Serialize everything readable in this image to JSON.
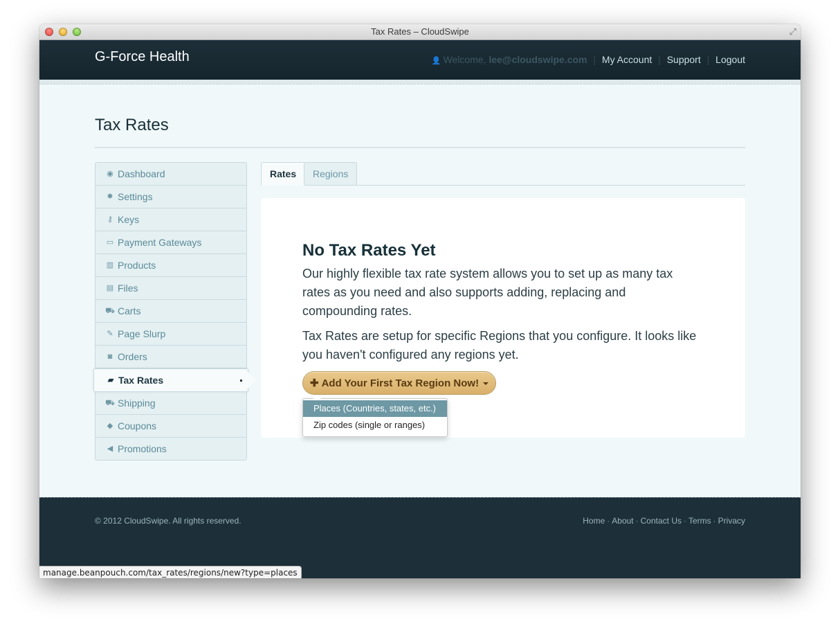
{
  "window": {
    "title": "Tax Rates – CloudSwipe"
  },
  "header": {
    "brand": "G-Force Health",
    "welcome_prefix": "Welcome,",
    "welcome_user": "lee@cloudswipe.com",
    "links": [
      "My Account",
      "Support",
      "Logout"
    ]
  },
  "page": {
    "title": "Tax Rates"
  },
  "sidebar": {
    "items": [
      {
        "label": "Dashboard",
        "icon": "dashboard-icon"
      },
      {
        "label": "Settings",
        "icon": "gear-icon"
      },
      {
        "label": "Keys",
        "icon": "key-icon"
      },
      {
        "label": "Payment Gateways",
        "icon": "credit-card-icon"
      },
      {
        "label": "Products",
        "icon": "barcode-icon"
      },
      {
        "label": "Files",
        "icon": "file-icon"
      },
      {
        "label": "Carts",
        "icon": "cart-icon"
      },
      {
        "label": "Page Slurp",
        "icon": "magic-wand-icon"
      },
      {
        "label": "Orders",
        "icon": "money-icon"
      },
      {
        "label": "Tax Rates",
        "icon": "book-icon",
        "active": true
      },
      {
        "label": "Shipping",
        "icon": "truck-icon"
      },
      {
        "label": "Coupons",
        "icon": "tags-icon"
      },
      {
        "label": "Promotions",
        "icon": "bullhorn-icon"
      }
    ]
  },
  "tabs": [
    "Rates",
    "Regions"
  ],
  "main": {
    "heading": "No Tax Rates Yet",
    "paragraph_1": "Our highly flexible tax rate system allows you to set up as many tax rates as you need and also supports adding, replacing and compounding rates.",
    "paragraph_2": "Tax Rates are setup for specific Regions that you configure. It looks like you haven't configured any regions yet.",
    "add_button": "Add Your First Tax Region Now!",
    "dropdown": [
      "Places (Countries, states, etc.)",
      "Zip codes (single or ranges)"
    ]
  },
  "footer": {
    "copyright": "© 2012 CloudSwipe. All rights reserved.",
    "links": [
      "Home",
      "About",
      "Contact Us",
      "Terms",
      "Privacy"
    ]
  },
  "status_bar": {
    "url": "manage.beanpouch.com/tax_rates/regions/new?type=places"
  },
  "colors": {
    "header": "#1d2f38",
    "accent": "#6d98a4",
    "button": "#d9b06b",
    "background": "#f1f8f9"
  }
}
